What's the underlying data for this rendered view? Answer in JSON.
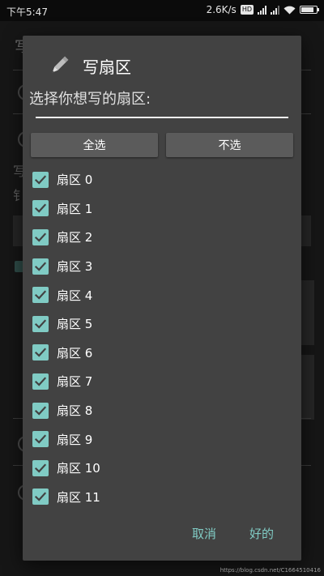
{
  "status_bar": {
    "time": "下午5:47",
    "network_speed": "2.6K/s",
    "hd_badge": "HD"
  },
  "background": {
    "title_fragment": "写",
    "text_fragment_1": "写",
    "text_fragment_2": "钅"
  },
  "dialog": {
    "title": "写扇区",
    "message": "选择你想写的扇区:",
    "input_value": "",
    "select_all_label": "全选",
    "select_none_label": "不选",
    "sectors": [
      {
        "label": "扇区 0",
        "checked": true
      },
      {
        "label": "扇区 1",
        "checked": true
      },
      {
        "label": "扇区 2",
        "checked": true
      },
      {
        "label": "扇区 3",
        "checked": true
      },
      {
        "label": "扇区 4",
        "checked": true
      },
      {
        "label": "扇区 5",
        "checked": true
      },
      {
        "label": "扇区 6",
        "checked": true
      },
      {
        "label": "扇区 7",
        "checked": true
      },
      {
        "label": "扇区 8",
        "checked": true
      },
      {
        "label": "扇区 9",
        "checked": true
      },
      {
        "label": "扇区 10",
        "checked": true
      },
      {
        "label": "扇区 11",
        "checked": true
      }
    ],
    "cancel_label": "取消",
    "ok_label": "好的",
    "icon": "pencil-icon",
    "accent_color": "#80cbc4"
  },
  "watermark": "https://blog.csdn.net/C1664510416"
}
